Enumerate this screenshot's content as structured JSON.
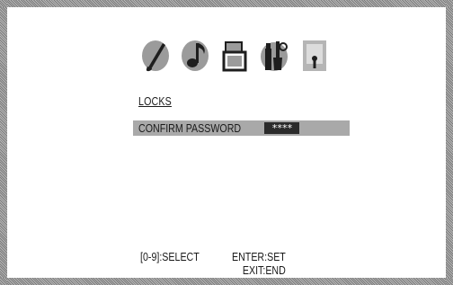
{
  "icons": [
    {
      "name": "picture-settings-icon"
    },
    {
      "name": "audio-settings-icon"
    },
    {
      "name": "setup-icon"
    },
    {
      "name": "tools-icon"
    },
    {
      "name": "lock-icon",
      "selected": true
    }
  ],
  "menu": {
    "title": "LOCKS",
    "rows": [
      {
        "label": "CONFIRM PASSWORD",
        "value": "****"
      }
    ]
  },
  "footer": {
    "select_hint": "[0-9]:SELECT",
    "set_hint": "ENTER:SET",
    "exit_hint": "EXIT:END"
  },
  "colors": {
    "highlight": "#a9a9a9",
    "password_bg": "#2b2b2b",
    "text": "#1a1a1a",
    "border": "#8a8a8a"
  }
}
